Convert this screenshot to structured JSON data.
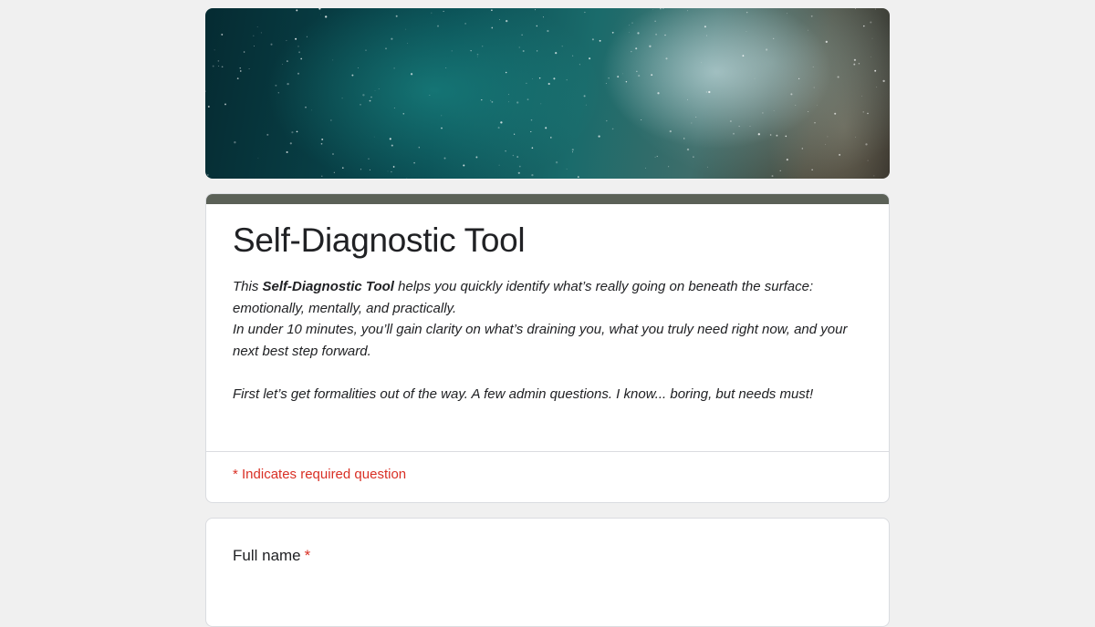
{
  "form": {
    "title": "Self-Diagnostic Tool",
    "description": {
      "line1_prefix": "This ",
      "line1_bold": "Self-Diagnostic Tool",
      "line1_suffix": " helps you quickly identify what’s really going on beneath the surface: emotionally, mentally, and practically.",
      "line2": "In under 10 minutes, you’ll gain clarity on what’s draining you, what you truly need right now, and your next best step forward.",
      "line3": "First let’s get formalities out of the way. A few admin questions. I know... boring, but needs must!"
    },
    "required_note": "* Indicates required question"
  },
  "questions": [
    {
      "label": "Full name",
      "required_mark": "*"
    }
  ],
  "colors": {
    "page_background": "#f0f0f0",
    "header_bar": "#5b6157",
    "required": "#d93025",
    "text": "#202124"
  }
}
